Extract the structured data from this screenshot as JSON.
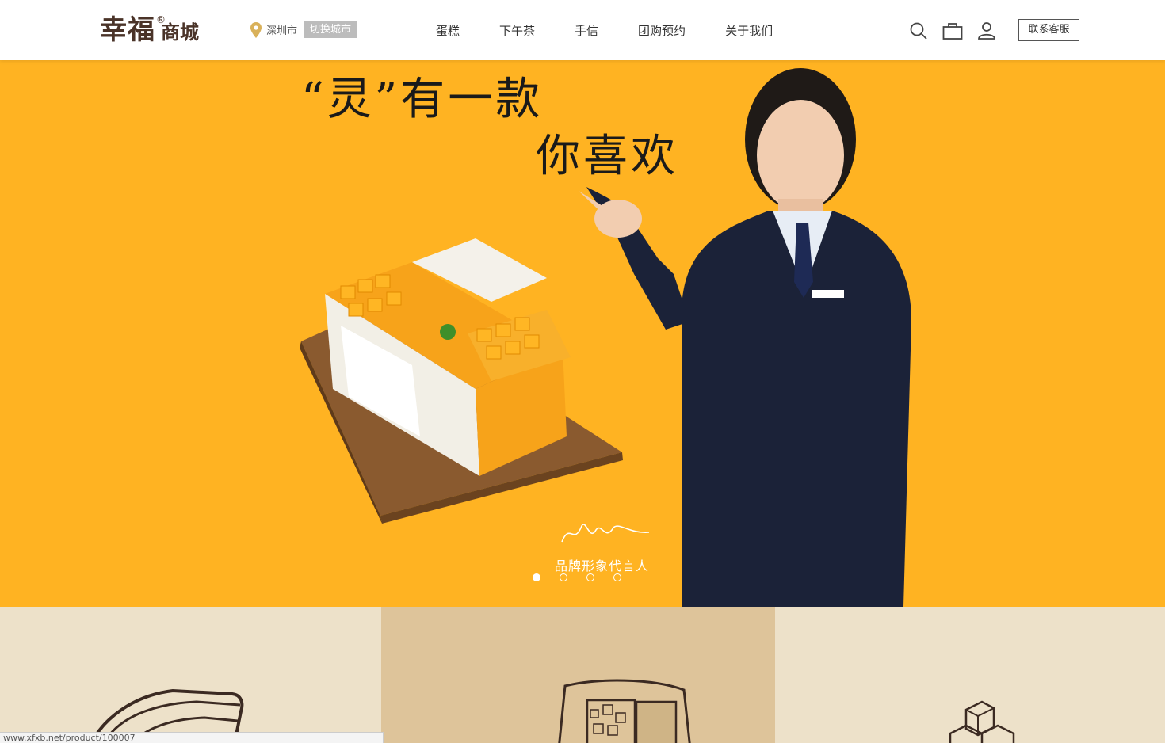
{
  "header": {
    "logo_main": "幸福",
    "logo_reg": "®",
    "logo_sub": "商城",
    "city": "深圳市",
    "switch_city": "切换城市",
    "nav": [
      "蛋糕",
      "下午茶",
      "手信",
      "团购预约",
      "关于我们"
    ],
    "contact_button": "联系客服",
    "icons": [
      "search-icon",
      "shopping-bag-icon",
      "user-icon"
    ]
  },
  "banner": {
    "slogan_line1": "“灵”有一款",
    "slogan_line2": "你喜欢",
    "caption": "品牌形象代言人",
    "slides": 4,
    "active_slide": 1,
    "background": "#ffb322"
  },
  "categories": [
    {
      "icon": "crepe-cake-icon",
      "background": "#ede1c9"
    },
    {
      "icon": "cake-box-icon",
      "background": "#dec49a"
    },
    {
      "icon": "stacked-cubes-icon",
      "background": "#ede1c9"
    }
  ],
  "status_bar": {
    "url": "www.xfxb.net/product/100007"
  }
}
